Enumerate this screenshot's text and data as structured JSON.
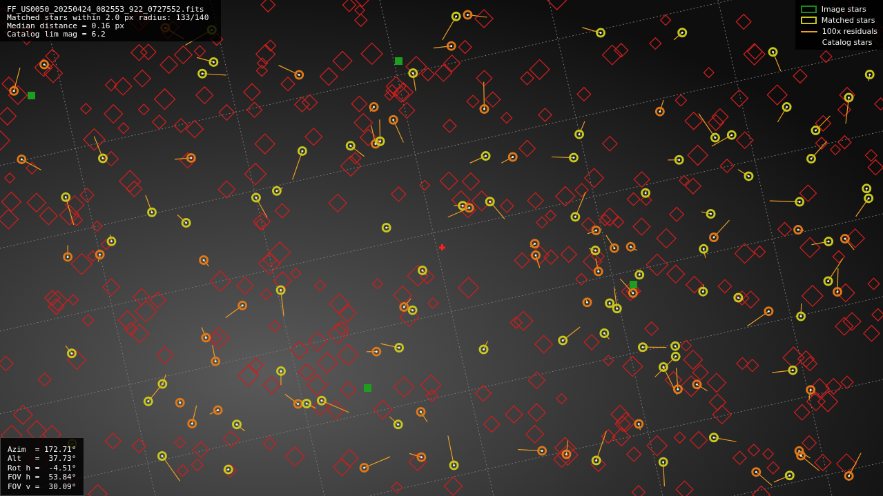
{
  "header": {
    "lines": [
      "FF_US0050_20250424_082553_922_0727552.fits",
      "Matched stars within 2.0 px radius: 133/140",
      "Median distance = 0.16 px",
      "Catalog lim mag = 6.2"
    ]
  },
  "legend": [
    {
      "label": "Image stars",
      "kind": "box",
      "color": "#1a8a1a"
    },
    {
      "label": "Matched stars",
      "kind": "box",
      "color": "#c8c81e"
    },
    {
      "label": "100x residuals",
      "kind": "line",
      "color": "#f0a020"
    },
    {
      "label": "Catalog stars",
      "kind": "none",
      "color": "#cc1f1f"
    }
  ],
  "pointing": {
    "lines": [
      "Azim  = 172.71°",
      "Alt   =  37.73°",
      "Rot h =  -4.51°",
      "FOV h =  53.84°",
      "FOV v =  30.09°"
    ]
  }
}
